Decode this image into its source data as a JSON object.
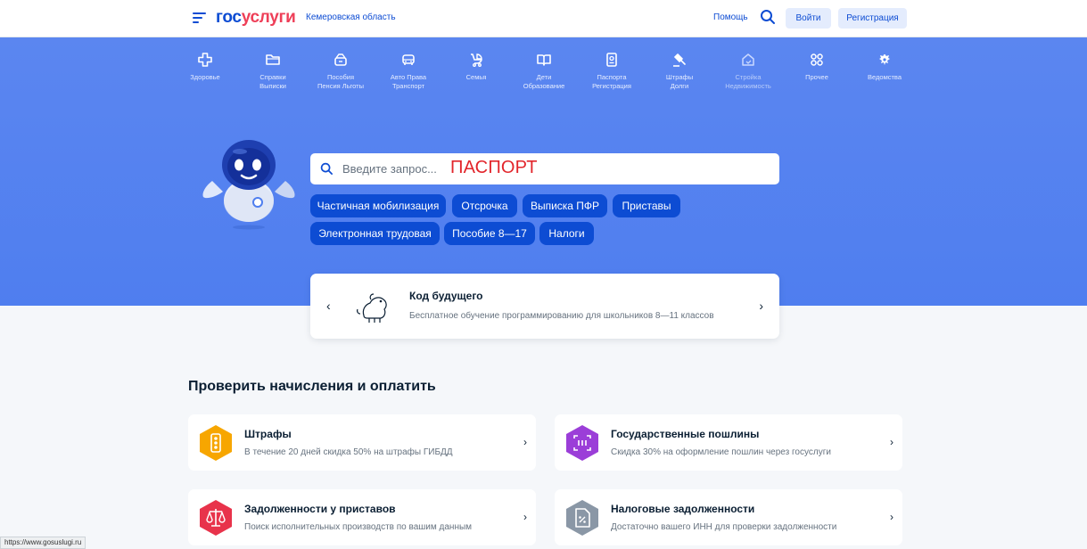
{
  "header": {
    "logo_part1": "гос",
    "logo_part2": "услуги",
    "region": "Кемеровская область",
    "help": "Помощь",
    "login": "Войти",
    "register": "Регистрация",
    "brand_blue": "#0d4cd3",
    "brand_red": "#ee3f58"
  },
  "categories": [
    {
      "label": "Здоровье",
      "icon": "health-cross-icon"
    },
    {
      "label": "Справки\nВыписки",
      "icon": "folder-icon"
    },
    {
      "label": "Пособия\nПенсия Льготы",
      "icon": "wallet-icon"
    },
    {
      "label": "Авто Права\nТранспорт",
      "icon": "car-icon"
    },
    {
      "label": "Семья",
      "icon": "stroller-icon"
    },
    {
      "label": "Дети\nОбразование",
      "icon": "book-icon"
    },
    {
      "label": "Паспорта\nРегистрация",
      "icon": "passport-icon"
    },
    {
      "label": "Штрафы\nДолги",
      "icon": "gavel-icon"
    },
    {
      "label": "Стройка\nНедвижимость",
      "icon": "house-icon"
    },
    {
      "label": "Прочее",
      "icon": "grid-icon"
    },
    {
      "label": "Ведомства",
      "icon": "emblem-icon"
    }
  ],
  "search": {
    "placeholder": "Введите запрос...",
    "typed_value": "ПАСПОРТ"
  },
  "quick_chips": [
    "Частичная мобилизация",
    "Отсрочка",
    "Выписка ПФР",
    "Приставы",
    "Электронная трудовая",
    "Пособие 8—17",
    "Налоги"
  ],
  "promo": {
    "title": "Код будущего",
    "subtitle": "Бесплатное обучение программированию для школьников 8—11 классов"
  },
  "section": {
    "title": "Проверить начисления и оплатить"
  },
  "cards": [
    {
      "title": "Штрафы",
      "subtitle": "В течение 20 дней скидка 50% на штрафы ГИБДД",
      "color": "#f7a600",
      "icon": "traffic-light-icon"
    },
    {
      "title": "Государственные пошлины",
      "subtitle": "Скидка 30% на оформление пошлин через госуслуги",
      "color": "#9b3ed8",
      "icon": "receipt-icon"
    },
    {
      "title": "Задолженности у приставов",
      "subtitle": "Поиск исполнительных производств по вашим данным",
      "color": "#e8334b",
      "icon": "scales-icon"
    },
    {
      "title": "Налоговые задолженности",
      "subtitle": "Достаточно вашего ИНН для проверки задолженности",
      "color": "#8a97a6",
      "icon": "tax-document-icon"
    }
  ],
  "status_bar": {
    "url": "https://www.gosuslugi.ru"
  }
}
